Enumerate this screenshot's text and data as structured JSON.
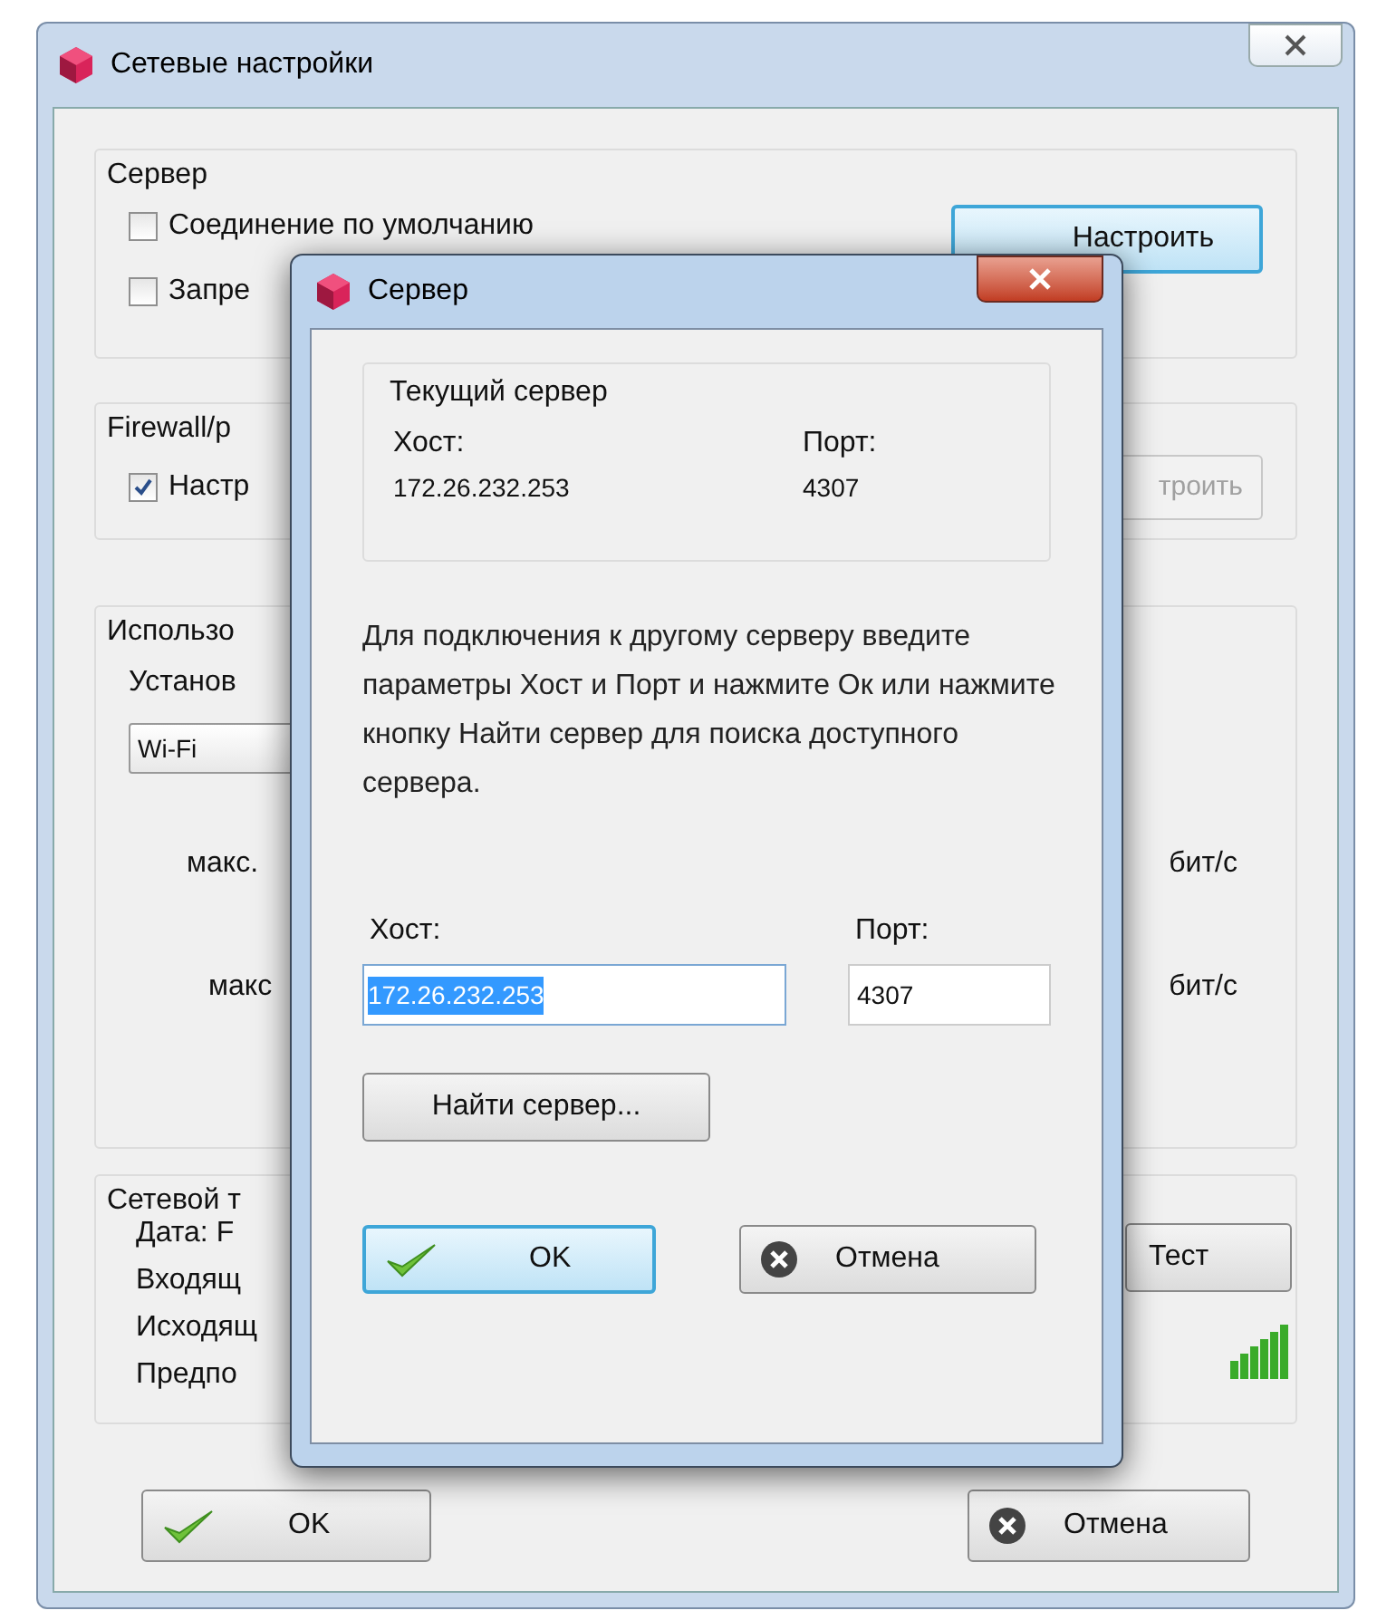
{
  "main_window": {
    "title": "Сетевые настройки",
    "server_group": {
      "title": "Сервер",
      "checkboxes": [
        {
          "label": "Соединение по умолчанию",
          "checked": false
        },
        {
          "label": "Запре",
          "checked": false
        }
      ],
      "button": "Настроить"
    },
    "firewall_group": {
      "title": "Firewall/p",
      "checkbox": {
        "label": "Настр",
        "checked": true
      },
      "button": {
        "label": "троить",
        "disabled": true
      }
    },
    "usage_group": {
      "title": "Использо",
      "label": "Установ",
      "select": "Wi-Fi",
      "limits": [
        {
          "label": "макс.",
          "unit": "бит/с"
        },
        {
          "label": "макс",
          "unit": "бит/с"
        }
      ]
    },
    "traffic_group": {
      "title": "Сетевой т",
      "lines": [
        "Дата: F",
        "Входящ",
        "Исходящ",
        "Предпо"
      ],
      "button": "Тест"
    },
    "ok_button": "OK",
    "cancel_button": "Отмена"
  },
  "dialog": {
    "title": "Сервер",
    "current": {
      "title": "Текущий сервер",
      "host_label": "Хост:",
      "host": "172.26.232.253",
      "port_label": "Порт:",
      "port": "4307"
    },
    "description": "Для подключения к другому серверу введите параметры Хост и Порт и нажмите Ок или нажмите кнопку Найти сервер для поиска доступного сервера.",
    "host_label": "Хост:",
    "host_value": "172.26.232.253",
    "host_selected": true,
    "port_label": "Порт:",
    "port_value": "4307",
    "find_button": "Найти сервер...",
    "ok_button": "OK",
    "cancel_button": "Отмена"
  }
}
